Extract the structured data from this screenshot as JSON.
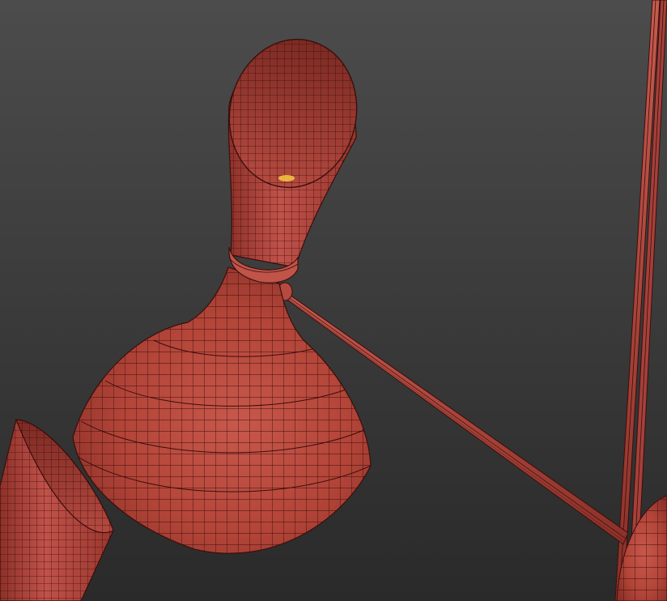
{
  "viewport": {
    "background_top": "#4a4a4a",
    "background_bottom": "#2b2b2b"
  },
  "model": {
    "base_color": "#b84a40",
    "highlight_color": "#c85a4e",
    "shadow_color": "#7a2a24",
    "wire_color": "#3a0e0c",
    "bulb_color": "#f0c040",
    "parts": [
      "lamp-shade-main",
      "lamp-neck-cone",
      "lamp-ring-collar",
      "lamp-arm-rod",
      "lamp-shade-left",
      "lamp-shade-right",
      "lamp-pole"
    ]
  }
}
